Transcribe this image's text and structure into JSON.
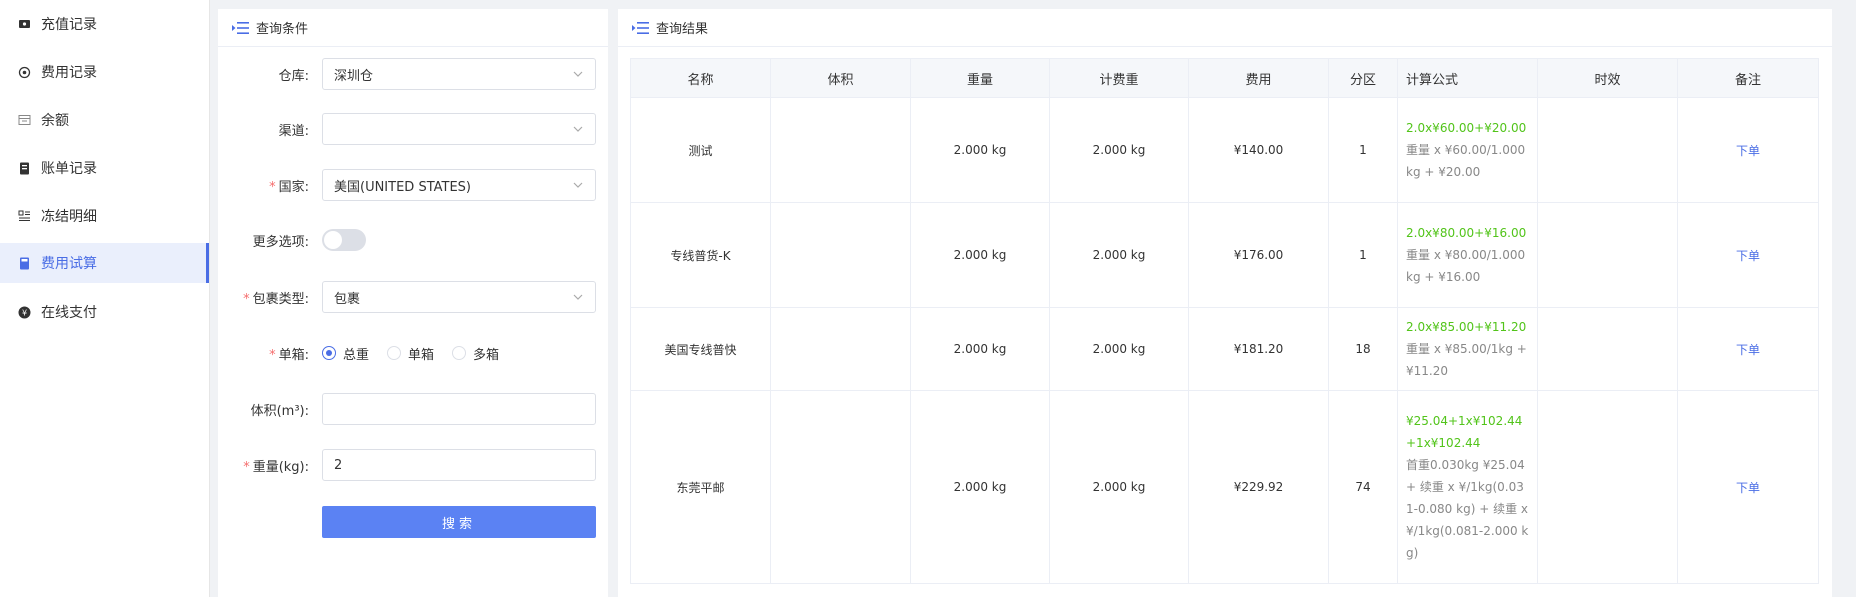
{
  "sidebar": {
    "items": [
      {
        "label": "充值记录",
        "icon": "ticket-icon",
        "active": false
      },
      {
        "label": "费用记录",
        "icon": "refresh-coin-icon",
        "active": false
      },
      {
        "label": "余额",
        "icon": "calendar-icon",
        "active": false
      },
      {
        "label": "账单记录",
        "icon": "bill-icon",
        "active": false
      },
      {
        "label": "冻结明细",
        "icon": "list-detail-icon",
        "active": false
      },
      {
        "label": "费用试算",
        "icon": "calculator-icon",
        "active": true
      },
      {
        "label": "在线支付",
        "icon": "yen-coin-icon",
        "active": false
      }
    ]
  },
  "query": {
    "title": "查询条件",
    "warehouse": {
      "label": "仓库:",
      "value": "深圳仓"
    },
    "channel": {
      "label": "渠道:",
      "value": ""
    },
    "country": {
      "label": "国家:",
      "value": "美国(UNITED STATES)"
    },
    "more_options": {
      "label": "更多选项:",
      "on": false
    },
    "package_type": {
      "label": "包裹类型:",
      "value": "包裹"
    },
    "box": {
      "label": "单箱:",
      "options": [
        "总重",
        "单箱",
        "多箱"
      ],
      "selected": "总重"
    },
    "volume": {
      "label": "体积(m³):",
      "value": ""
    },
    "weight": {
      "label": "重量(kg):",
      "value": "2"
    },
    "search_label": "搜索"
  },
  "result": {
    "title": "查询结果",
    "columns": [
      "名称",
      "体积",
      "重量",
      "计费重",
      "费用",
      "分区",
      "计算公式",
      "时效",
      "备注"
    ],
    "rows": [
      {
        "name": "测试",
        "volume": "",
        "weight": "2.000 kg",
        "charge_weight": "2.000 kg",
        "fee": "¥140.00",
        "zone": "1",
        "formula_green": "2.0x¥60.00+¥20.00",
        "formula_gray": "重量 x ¥60.00/1.000kg + ¥20.00",
        "aging": "",
        "action": "下单"
      },
      {
        "name": "专线普货-K",
        "volume": "",
        "weight": "2.000 kg",
        "charge_weight": "2.000 kg",
        "fee": "¥176.00",
        "zone": "1",
        "formula_green": "2.0x¥80.00+¥16.00",
        "formula_gray": "重量 x ¥80.00/1.000kg + ¥16.00",
        "aging": "",
        "action": "下单"
      },
      {
        "name": "美国专线普快",
        "volume": "",
        "weight": "2.000 kg",
        "charge_weight": "2.000 kg",
        "fee": "¥181.20",
        "zone": "18",
        "formula_green": "2.0x¥85.00+¥11.20",
        "formula_gray": "重量 x ¥85.00/1kg + ¥11.20",
        "aging": "",
        "action": "下单"
      },
      {
        "name": "东莞平邮",
        "volume": "",
        "weight": "2.000 kg",
        "charge_weight": "2.000 kg",
        "fee": "¥229.92",
        "zone": "74",
        "formula_green": "¥25.04+1x¥102.44 +1x¥102.44",
        "formula_gray": "首重0.030kg ¥25.04 + 续重 x ¥/1kg(0.031-0.080 kg) + 续重 x ¥/1kg(0.081-2.000 kg)",
        "aging": "",
        "action": "下单"
      }
    ]
  },
  "colors": {
    "accent": "#4a6de5",
    "formula_green": "#52c41a",
    "required": "#f56c6c",
    "button": "#5b82f3"
  }
}
